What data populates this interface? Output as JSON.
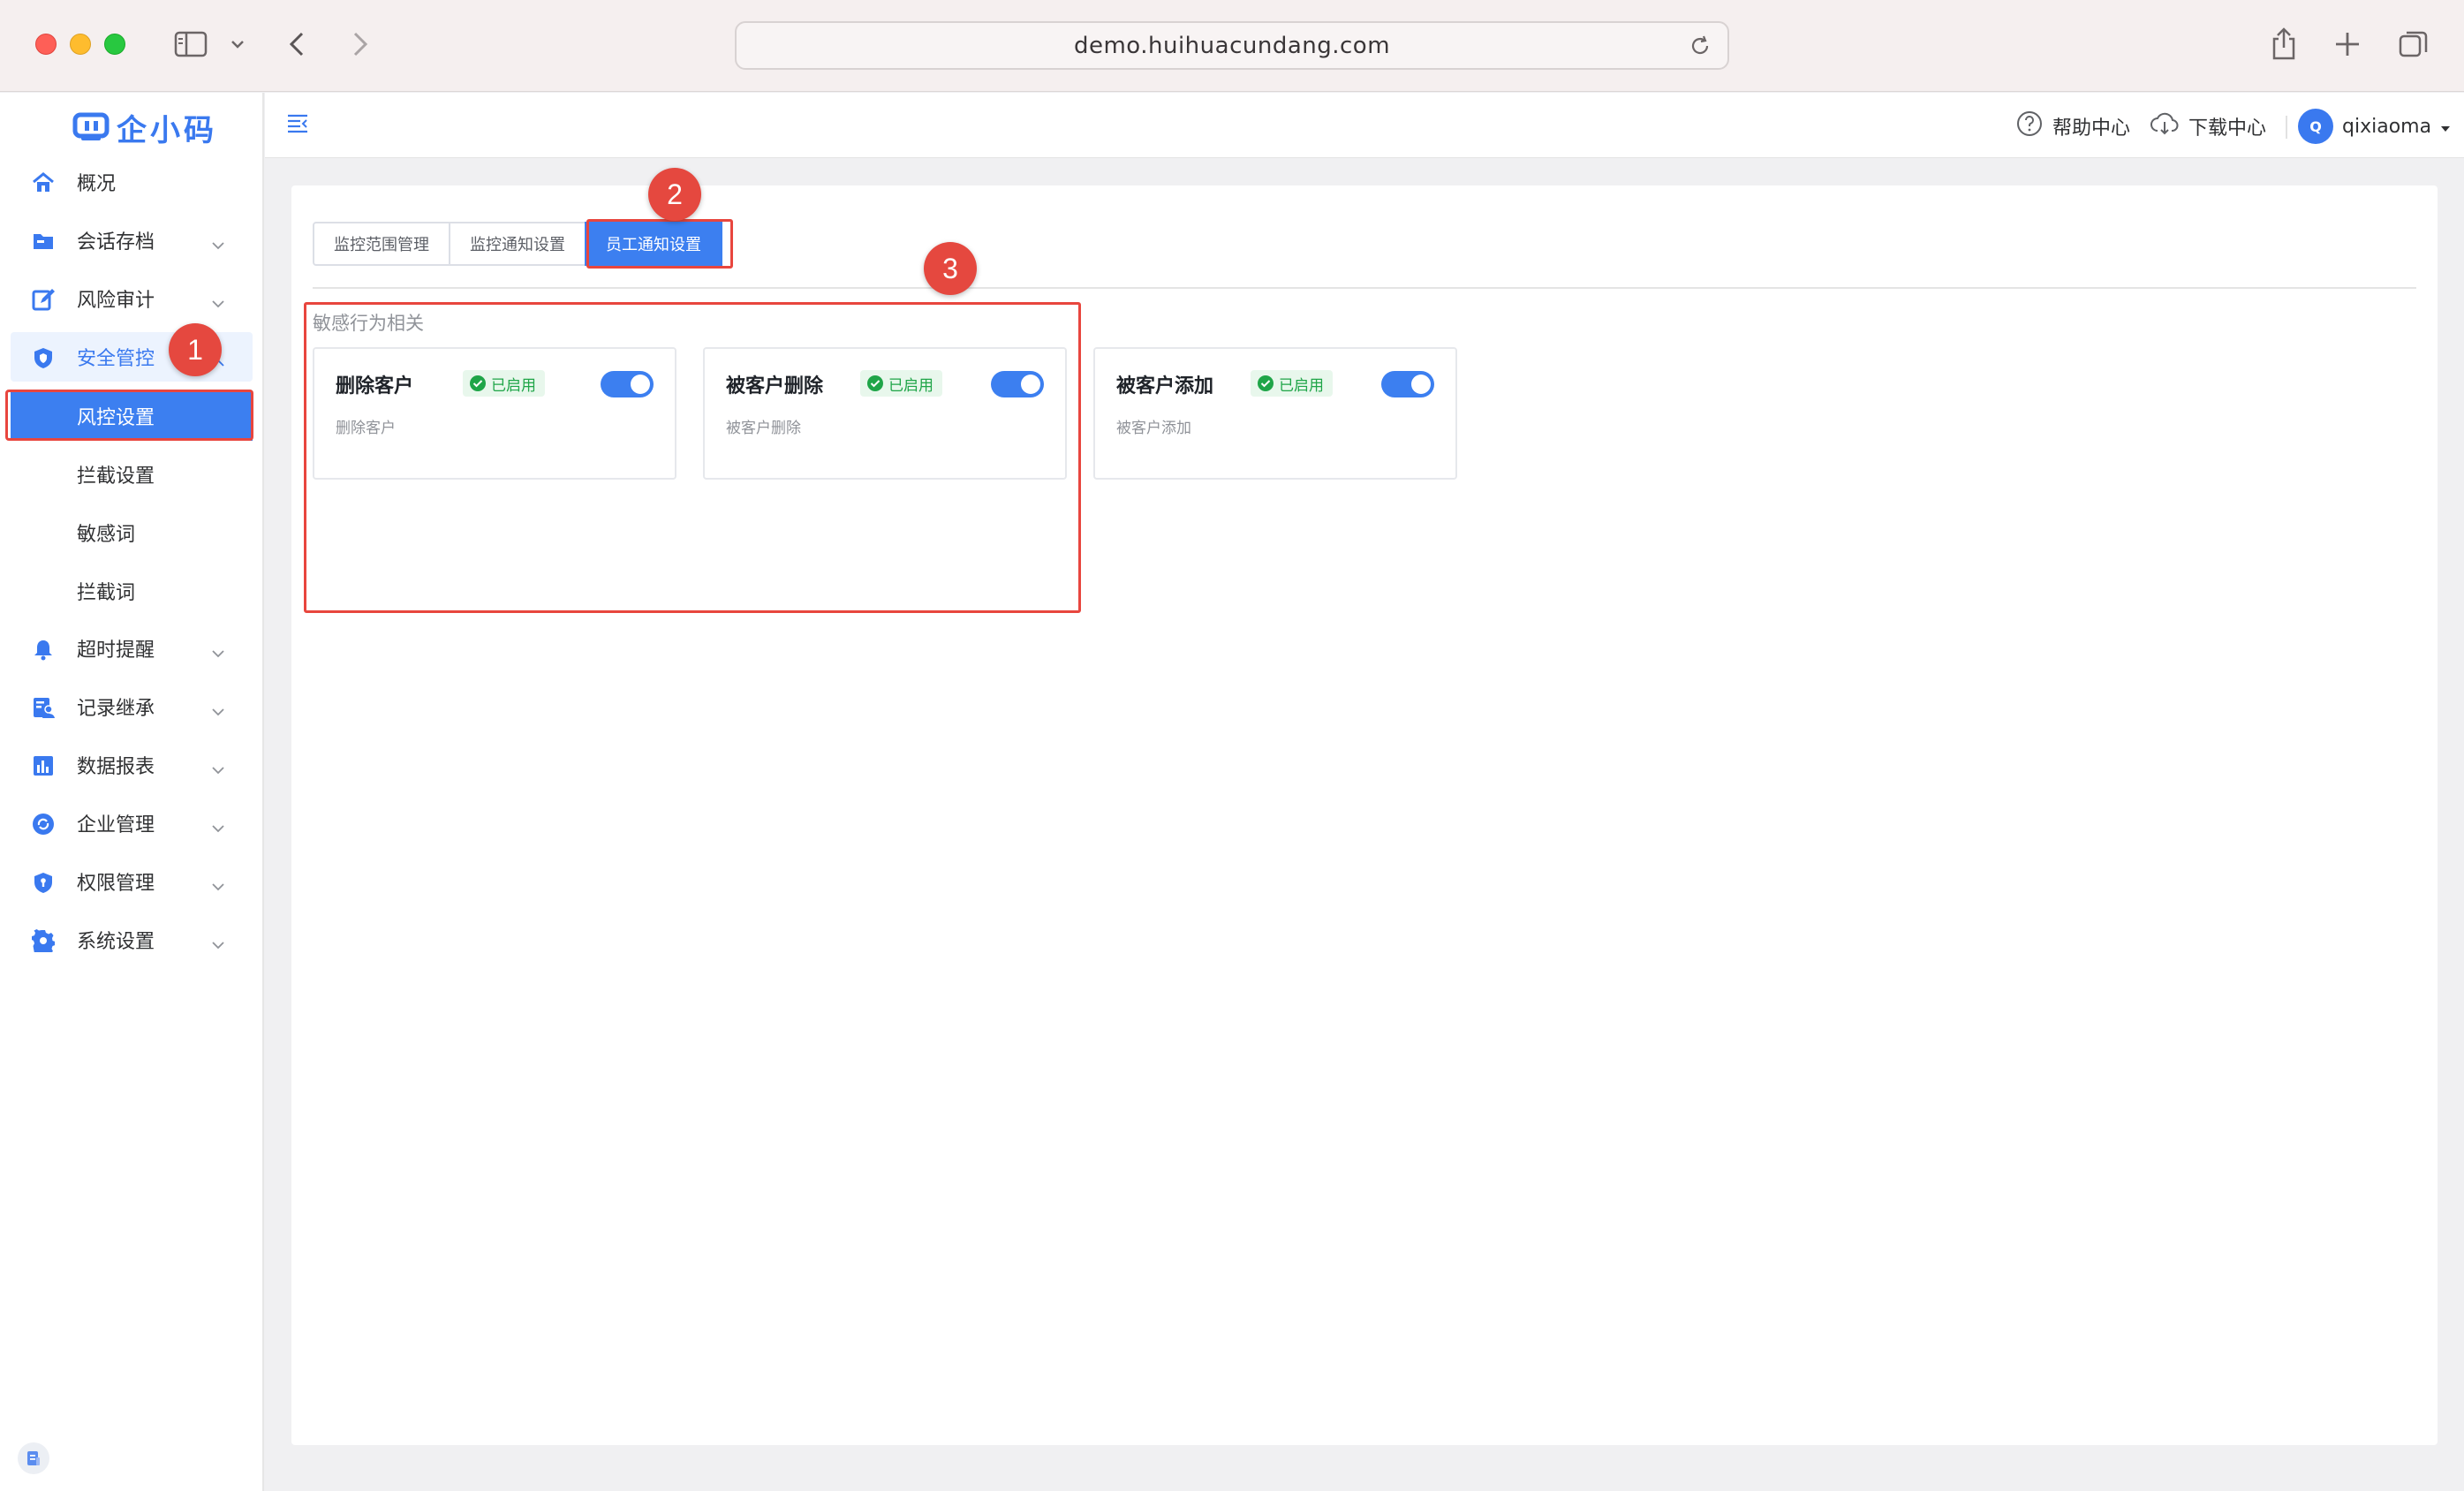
{
  "browser": {
    "url": "demo.huihuacundang.com"
  },
  "sidebar": {
    "logo": "企小码",
    "items": [
      {
        "label": "概况",
        "icon": "home-icon",
        "expandable": false
      },
      {
        "label": "会话存档",
        "icon": "folder-icon",
        "expandable": true
      },
      {
        "label": "风险审计",
        "icon": "edit-icon",
        "expandable": true
      },
      {
        "label": "安全管控",
        "icon": "shield-icon",
        "expandable": true,
        "expanded": true
      },
      {
        "label": "超时提醒",
        "icon": "bell-icon",
        "expandable": true
      },
      {
        "label": "记录继承",
        "icon": "user-record-icon",
        "expandable": true
      },
      {
        "label": "数据报表",
        "icon": "bar-chart-icon",
        "expandable": true
      },
      {
        "label": "企业管理",
        "icon": "refresh-circle-icon",
        "expandable": true
      },
      {
        "label": "权限管理",
        "icon": "shield-lock-icon",
        "expandable": true
      },
      {
        "label": "系统设置",
        "icon": "gear-icon",
        "expandable": true
      }
    ],
    "subitems": [
      {
        "label": "风控设置",
        "selected": true
      },
      {
        "label": "拦截设置"
      },
      {
        "label": "敏感词"
      },
      {
        "label": "拦截词"
      }
    ]
  },
  "topbar": {
    "help_label": "帮助中心",
    "download_label": "下载中心",
    "user_initial": "Q",
    "username": "qixiaoma"
  },
  "tabs": [
    {
      "label": "监控范围管理",
      "active": false
    },
    {
      "label": "监控通知设置",
      "active": false
    },
    {
      "label": "员工通知设置",
      "active": true
    }
  ],
  "section": {
    "title": "敏感行为相关",
    "cards": [
      {
        "title": "删除客户",
        "status": "已启用",
        "description": "删除客户",
        "enabled": true
      },
      {
        "title": "被客户删除",
        "status": "已启用",
        "description": "被客户删除",
        "enabled": true
      },
      {
        "title": "被客户添加",
        "status": "已启用",
        "description": "被客户添加",
        "enabled": true
      }
    ]
  },
  "steps": [
    "1",
    "2",
    "3"
  ],
  "colors": {
    "primary": "#3c7ff0",
    "highlight": "#e8463e",
    "success": "#1fa548"
  }
}
